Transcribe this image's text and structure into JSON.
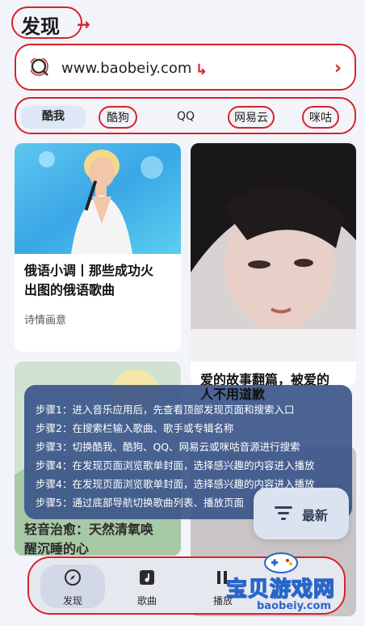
{
  "header": {
    "title": "发现"
  },
  "search": {
    "text": "www.baobeiy.com"
  },
  "tabs": [
    {
      "label": "酷我"
    },
    {
      "label": "酷狗"
    },
    {
      "label": "QQ"
    },
    {
      "label": "网易云"
    },
    {
      "label": "咪咕"
    }
  ],
  "cards": [
    {
      "title_line1": "俄语小调丨那些成功火",
      "title_line2": "出图的俄语歌曲",
      "subtitle": "诗情画意"
    },
    {
      "title_line1": "爱的故事翻篇，被爱的",
      "title_line2": "人不用道歉"
    },
    {
      "title_line1": "轻音治愈：天然清氧唤",
      "title_line2": "醒沉睡的心"
    }
  ],
  "steps": [
    "步骤1：进入音乐应用后，先查看顶部发现页面和搜索入口",
    "步骤2：在搜索栏输入歌曲、歌手或专辑名称",
    "步骤3：切换酷我、酷狗、QQ、网易云或咪咕音源进行搜索",
    "步骤4：在发现页面浏览歌单封面，选择感兴趣的内容进入播放",
    "步骤4：在发现页面浏览歌单封面，选择感兴趣的内容进入播放",
    "步骤5：通过底部导航切换歌曲列表、播放页面"
  ],
  "newest": {
    "label": "最新"
  },
  "nav": [
    {
      "label": "发现",
      "icon": "compass-icon"
    },
    {
      "label": "歌曲",
      "icon": "music-library-icon"
    },
    {
      "label": "播放",
      "icon": "play-icon"
    }
  ],
  "watermark": {
    "text": "宝贝游戏网",
    "url": "baobeiy.com"
  },
  "colors": {
    "annotation": "#d8232a",
    "overlay": "#3c568a",
    "tab_active": "#dde7f6"
  }
}
